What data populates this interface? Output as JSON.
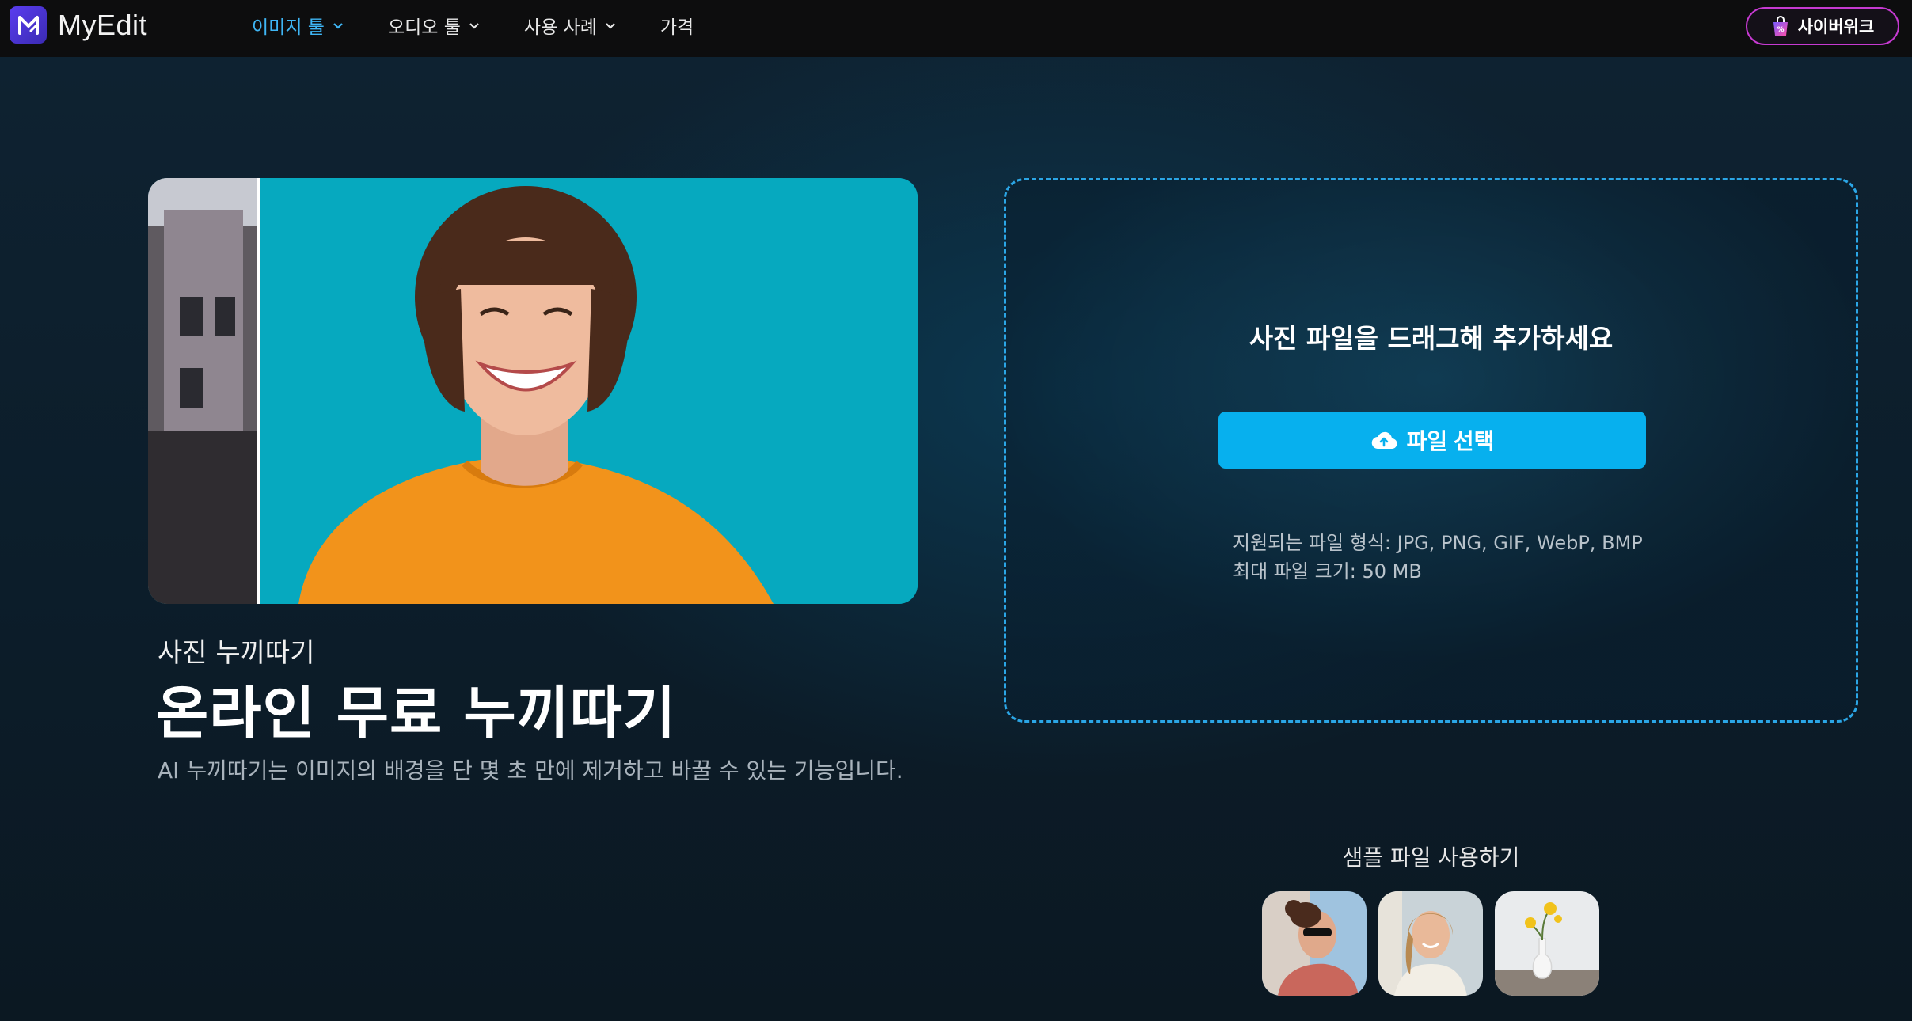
{
  "nav": {
    "logo_text": "MyEdit",
    "items": [
      {
        "label": "이미지 툴",
        "dropdown": true,
        "active": true
      },
      {
        "label": "오디오 툴",
        "dropdown": true,
        "active": false
      },
      {
        "label": "사용 사례",
        "dropdown": true,
        "active": false
      },
      {
        "label": "가격",
        "dropdown": false,
        "active": false
      }
    ],
    "promo_label": "사이버위크"
  },
  "hero": {
    "subtitle": "사진 누끼따기",
    "title": "온라인 무료 누끼따기",
    "description": "AI 누끼따기는 이미지의 배경을 단 몇 초 만에 제거하고 바꿀 수 있는 기능입니다."
  },
  "upload": {
    "prompt": "사진 파일을 드래그해 추가하세요",
    "button_label": "파일 선택",
    "supported_formats": "지원되는 파일 형식: JPG, PNG, GIF, WebP, BMP",
    "max_size": "최대 파일 크기: 50 MB"
  },
  "samples": {
    "title": "샘플 파일 사용하기",
    "items": [
      "sample-woman-sunglasses",
      "sample-woman-smiling",
      "sample-flower-vase"
    ]
  },
  "colors": {
    "accent": "#07b0ee",
    "nav_active": "#3fb6f5",
    "dashed_border": "#2ba6e6",
    "promo_border": "#c63ad1",
    "hero_bg": "#06a9bf"
  }
}
